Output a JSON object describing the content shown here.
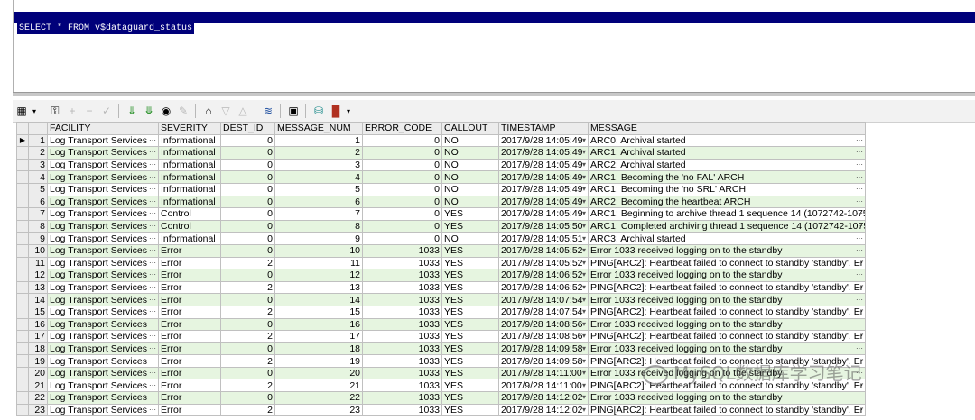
{
  "editor": {
    "sql": "SELECT * FROM v$dataguard_status"
  },
  "toolbar": {
    "icons": [
      "grid-icon",
      "dropdown-arrow-icon",
      "lock-icon",
      "plus-icon",
      "minus-icon",
      "check-icon",
      "arrow-down-green-icon",
      "arrow-down-all-icon",
      "binoculars-icon",
      "eraser-icon",
      "home-filter-icon",
      "triangle-down-icon",
      "triangle-up-icon",
      "chart-icon",
      "save-icon",
      "database-icon",
      "bar-chart-icon",
      "dropdown-arrow-icon"
    ]
  },
  "grid": {
    "columns": [
      "FACILITY",
      "SEVERITY",
      "DEST_ID",
      "MESSAGE_NUM",
      "ERROR_CODE",
      "CALLOUT",
      "TIMESTAMP",
      "MESSAGE"
    ],
    "rows": [
      {
        "n": "1",
        "facility": "Log Transport Services",
        "severity": "Informational",
        "dest": "0",
        "num": "1",
        "err": "0",
        "callout": "NO",
        "ts": "2017/9/28 14:05:49",
        "msg": "ARC0: Archival started"
      },
      {
        "n": "2",
        "facility": "Log Transport Services",
        "severity": "Informational",
        "dest": "0",
        "num": "2",
        "err": "0",
        "callout": "NO",
        "ts": "2017/9/28 14:05:49",
        "msg": "ARC1: Archival started"
      },
      {
        "n": "3",
        "facility": "Log Transport Services",
        "severity": "Informational",
        "dest": "0",
        "num": "3",
        "err": "0",
        "callout": "NO",
        "ts": "2017/9/28 14:05:49",
        "msg": "ARC2: Archival started"
      },
      {
        "n": "4",
        "facility": "Log Transport Services",
        "severity": "Informational",
        "dest": "0",
        "num": "4",
        "err": "0",
        "callout": "NO",
        "ts": "2017/9/28 14:05:49",
        "msg": "ARC1: Becoming the 'no FAL' ARCH"
      },
      {
        "n": "5",
        "facility": "Log Transport Services",
        "severity": "Informational",
        "dest": "0",
        "num": "5",
        "err": "0",
        "callout": "NO",
        "ts": "2017/9/28 14:05:49",
        "msg": "ARC1: Becoming the 'no SRL' ARCH"
      },
      {
        "n": "6",
        "facility": "Log Transport Services",
        "severity": "Informational",
        "dest": "0",
        "num": "6",
        "err": "0",
        "callout": "NO",
        "ts": "2017/9/28 14:05:49",
        "msg": "ARC2: Becoming the heartbeat ARCH"
      },
      {
        "n": "7",
        "facility": "Log Transport Services",
        "severity": "Control",
        "dest": "0",
        "num": "7",
        "err": "0",
        "callout": "YES",
        "ts": "2017/9/28 14:05:49",
        "msg": "ARC1: Beginning to archive thread 1 sequence 14 (1072742-1075"
      },
      {
        "n": "8",
        "facility": "Log Transport Services",
        "severity": "Control",
        "dest": "0",
        "num": "8",
        "err": "0",
        "callout": "YES",
        "ts": "2017/9/28 14:05:50",
        "msg": "ARC1: Completed archiving thread 1 sequence 14 (1072742-1075"
      },
      {
        "n": "9",
        "facility": "Log Transport Services",
        "severity": "Informational",
        "dest": "0",
        "num": "9",
        "err": "0",
        "callout": "NO",
        "ts": "2017/9/28 14:05:51",
        "msg": "ARC3: Archival started"
      },
      {
        "n": "10",
        "facility": "Log Transport Services",
        "severity": "Error",
        "dest": "0",
        "num": "10",
        "err": "1033",
        "callout": "YES",
        "ts": "2017/9/28 14:05:52",
        "msg": "Error 1033 received logging on to the standby"
      },
      {
        "n": "11",
        "facility": "Log Transport Services",
        "severity": "Error",
        "dest": "2",
        "num": "11",
        "err": "1033",
        "callout": "YES",
        "ts": "2017/9/28 14:05:52",
        "msg": "PING[ARC2]: Heartbeat failed to connect to standby 'standby'. Er"
      },
      {
        "n": "12",
        "facility": "Log Transport Services",
        "severity": "Error",
        "dest": "0",
        "num": "12",
        "err": "1033",
        "callout": "YES",
        "ts": "2017/9/28 14:06:52",
        "msg": "Error 1033 received logging on to the standby"
      },
      {
        "n": "13",
        "facility": "Log Transport Services",
        "severity": "Error",
        "dest": "2",
        "num": "13",
        "err": "1033",
        "callout": "YES",
        "ts": "2017/9/28 14:06:52",
        "msg": "PING[ARC2]: Heartbeat failed to connect to standby 'standby'. Er"
      },
      {
        "n": "14",
        "facility": "Log Transport Services",
        "severity": "Error",
        "dest": "0",
        "num": "14",
        "err": "1033",
        "callout": "YES",
        "ts": "2017/9/28 14:07:54",
        "msg": "Error 1033 received logging on to the standby"
      },
      {
        "n": "15",
        "facility": "Log Transport Services",
        "severity": "Error",
        "dest": "2",
        "num": "15",
        "err": "1033",
        "callout": "YES",
        "ts": "2017/9/28 14:07:54",
        "msg": "PING[ARC2]: Heartbeat failed to connect to standby 'standby'. Er"
      },
      {
        "n": "16",
        "facility": "Log Transport Services",
        "severity": "Error",
        "dest": "0",
        "num": "16",
        "err": "1033",
        "callout": "YES",
        "ts": "2017/9/28 14:08:56",
        "msg": "Error 1033 received logging on to the standby"
      },
      {
        "n": "17",
        "facility": "Log Transport Services",
        "severity": "Error",
        "dest": "2",
        "num": "17",
        "err": "1033",
        "callout": "YES",
        "ts": "2017/9/28 14:08:56",
        "msg": "PING[ARC2]: Heartbeat failed to connect to standby 'standby'. Er"
      },
      {
        "n": "18",
        "facility": "Log Transport Services",
        "severity": "Error",
        "dest": "0",
        "num": "18",
        "err": "1033",
        "callout": "YES",
        "ts": "2017/9/28 14:09:58",
        "msg": "Error 1033 received logging on to the standby"
      },
      {
        "n": "19",
        "facility": "Log Transport Services",
        "severity": "Error",
        "dest": "2",
        "num": "19",
        "err": "1033",
        "callout": "YES",
        "ts": "2017/9/28 14:09:58",
        "msg": "PING[ARC2]: Heartbeat failed to connect to standby 'standby'. Er"
      },
      {
        "n": "20",
        "facility": "Log Transport Services",
        "severity": "Error",
        "dest": "0",
        "num": "20",
        "err": "1033",
        "callout": "YES",
        "ts": "2017/9/28 14:11:00",
        "msg": "Error 1033 received logging on to the standby"
      },
      {
        "n": "21",
        "facility": "Log Transport Services",
        "severity": "Error",
        "dest": "2",
        "num": "21",
        "err": "1033",
        "callout": "YES",
        "ts": "2017/9/28 14:11:00",
        "msg": "PING[ARC2]: Heartbeat failed to connect to standby 'standby'. Er"
      },
      {
        "n": "22",
        "facility": "Log Transport Services",
        "severity": "Error",
        "dest": "0",
        "num": "22",
        "err": "1033",
        "callout": "YES",
        "ts": "2017/9/28 14:12:02",
        "msg": "Error 1033 received logging on to the standby"
      },
      {
        "n": "23",
        "facility": "Log Transport Services",
        "severity": "Error",
        "dest": "2",
        "num": "23",
        "err": "1033",
        "callout": "YES",
        "ts": "2017/9/28 14:12:02",
        "msg": "PING[ARC2]: Heartbeat failed to connect to standby 'standby'. Er"
      }
    ]
  },
  "watermark": {
    "text": "MySQL数据库学习笔记"
  }
}
